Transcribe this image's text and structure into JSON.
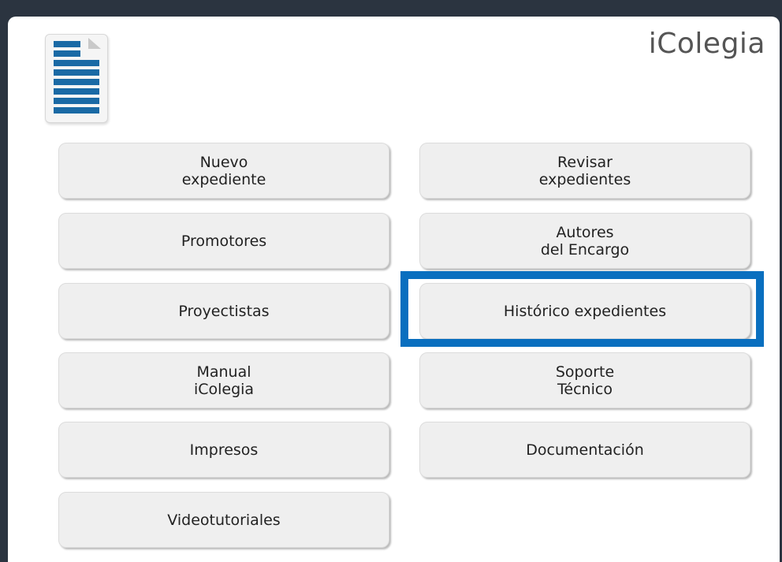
{
  "app": {
    "title": "iColegia",
    "logo_icon": "document-icon"
  },
  "colors": {
    "background": "#2b3440",
    "button_bg": "#efefef",
    "highlight": "#0a6fbf",
    "logo_blue": "#1a6aa5"
  },
  "menu": {
    "left": [
      {
        "line1": "Nuevo",
        "line2": "expediente"
      },
      {
        "line1": "Promotores",
        "line2": ""
      },
      {
        "line1": "Proyectistas",
        "line2": ""
      },
      {
        "line1": "Manual",
        "line2": "iColegia"
      },
      {
        "line1": "Impresos",
        "line2": ""
      },
      {
        "line1": "Videotutoriales",
        "line2": ""
      }
    ],
    "right": [
      {
        "line1": "Revisar",
        "line2": "expedientes"
      },
      {
        "line1": "Autores",
        "line2": "del Encargo"
      },
      {
        "line1": "Histórico expedientes",
        "line2": ""
      },
      {
        "line1": "Soporte",
        "line2": "Técnico"
      },
      {
        "line1": "Documentación",
        "line2": ""
      }
    ]
  },
  "highlighted_item": "Histórico expedientes"
}
